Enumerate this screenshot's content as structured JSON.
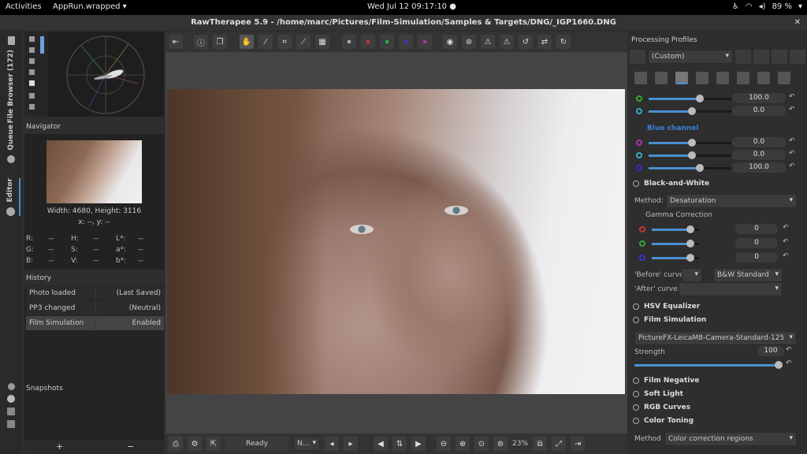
{
  "gnome": {
    "activities": "Activities",
    "app": "AppRun.wrapped ▾",
    "clock": "Wed Jul 12  09:17:10  ●",
    "battery": "89 %"
  },
  "window": {
    "title": "RawTherapee 5.9 - /home/marc/Pictures/Film-Simulation/Samples & Targets/DNG/_IGP1660.DNG",
    "close": "✕"
  },
  "vtabs": {
    "file_browser": "File Browser (172)",
    "queue": "Queue",
    "editor": "Editor"
  },
  "navigator": {
    "title": "Navigator",
    "size": "Width: 4680, Height: 3116",
    "coords": "x: --, y: --",
    "values": [
      [
        "R:",
        "--",
        "H:",
        "--",
        "L*:",
        "--"
      ],
      [
        "G:",
        "--",
        "S:",
        "--",
        "a*:",
        "--"
      ],
      [
        "B:",
        "--",
        "V:",
        "--",
        "b*:",
        "--"
      ]
    ]
  },
  "history": {
    "title": "History",
    "rows": [
      {
        "action": "Photo loaded",
        "value": "(Last Saved)"
      },
      {
        "action": "PP3 changed",
        "value": "(Neutral)"
      },
      {
        "action": "Film Simulation",
        "value": "Enabled"
      }
    ]
  },
  "snapshots": {
    "title": "Snapshots",
    "add": "+",
    "remove": "−"
  },
  "status": {
    "ready": "Ready",
    "zoom": "23%",
    "combo": "N..."
  },
  "right": {
    "pp_title": "Processing Profiles",
    "profile": "(Custom)",
    "green_rows": [
      {
        "value": "100.0"
      },
      {
        "value": "0.0"
      }
    ],
    "blue_channel": "Blue channel",
    "blue_rows": [
      {
        "value": "0.0"
      },
      {
        "value": "0.0"
      },
      {
        "value": "100.0"
      }
    ],
    "bw": {
      "title": "Black-and-White",
      "method_label": "Method:",
      "method": "Desaturation",
      "gamma": "Gamma Correction",
      "gamma_rows": [
        {
          "value": "0"
        },
        {
          "value": "0"
        },
        {
          "value": "0"
        }
      ],
      "before_label": "'Before' curve:",
      "before_value": "B&W Standard",
      "after_label": "'After' curve:"
    },
    "hsv": "HSV Equalizer",
    "film": {
      "title": "Film Simulation",
      "profile": "PictureFX-LeicaM8-Camera-Standard-125",
      "strength_label": "Strength",
      "strength": "100"
    },
    "film_negative": "Film Negative",
    "soft_light": "Soft Light",
    "rgb_curves": "RGB Curves",
    "color_toning": "Color Toning",
    "ct": {
      "method_label": "Method",
      "method": "Color correction regions"
    }
  },
  "colors": {
    "accent": "#4a8fd0",
    "bg": "#2e2e2e"
  }
}
